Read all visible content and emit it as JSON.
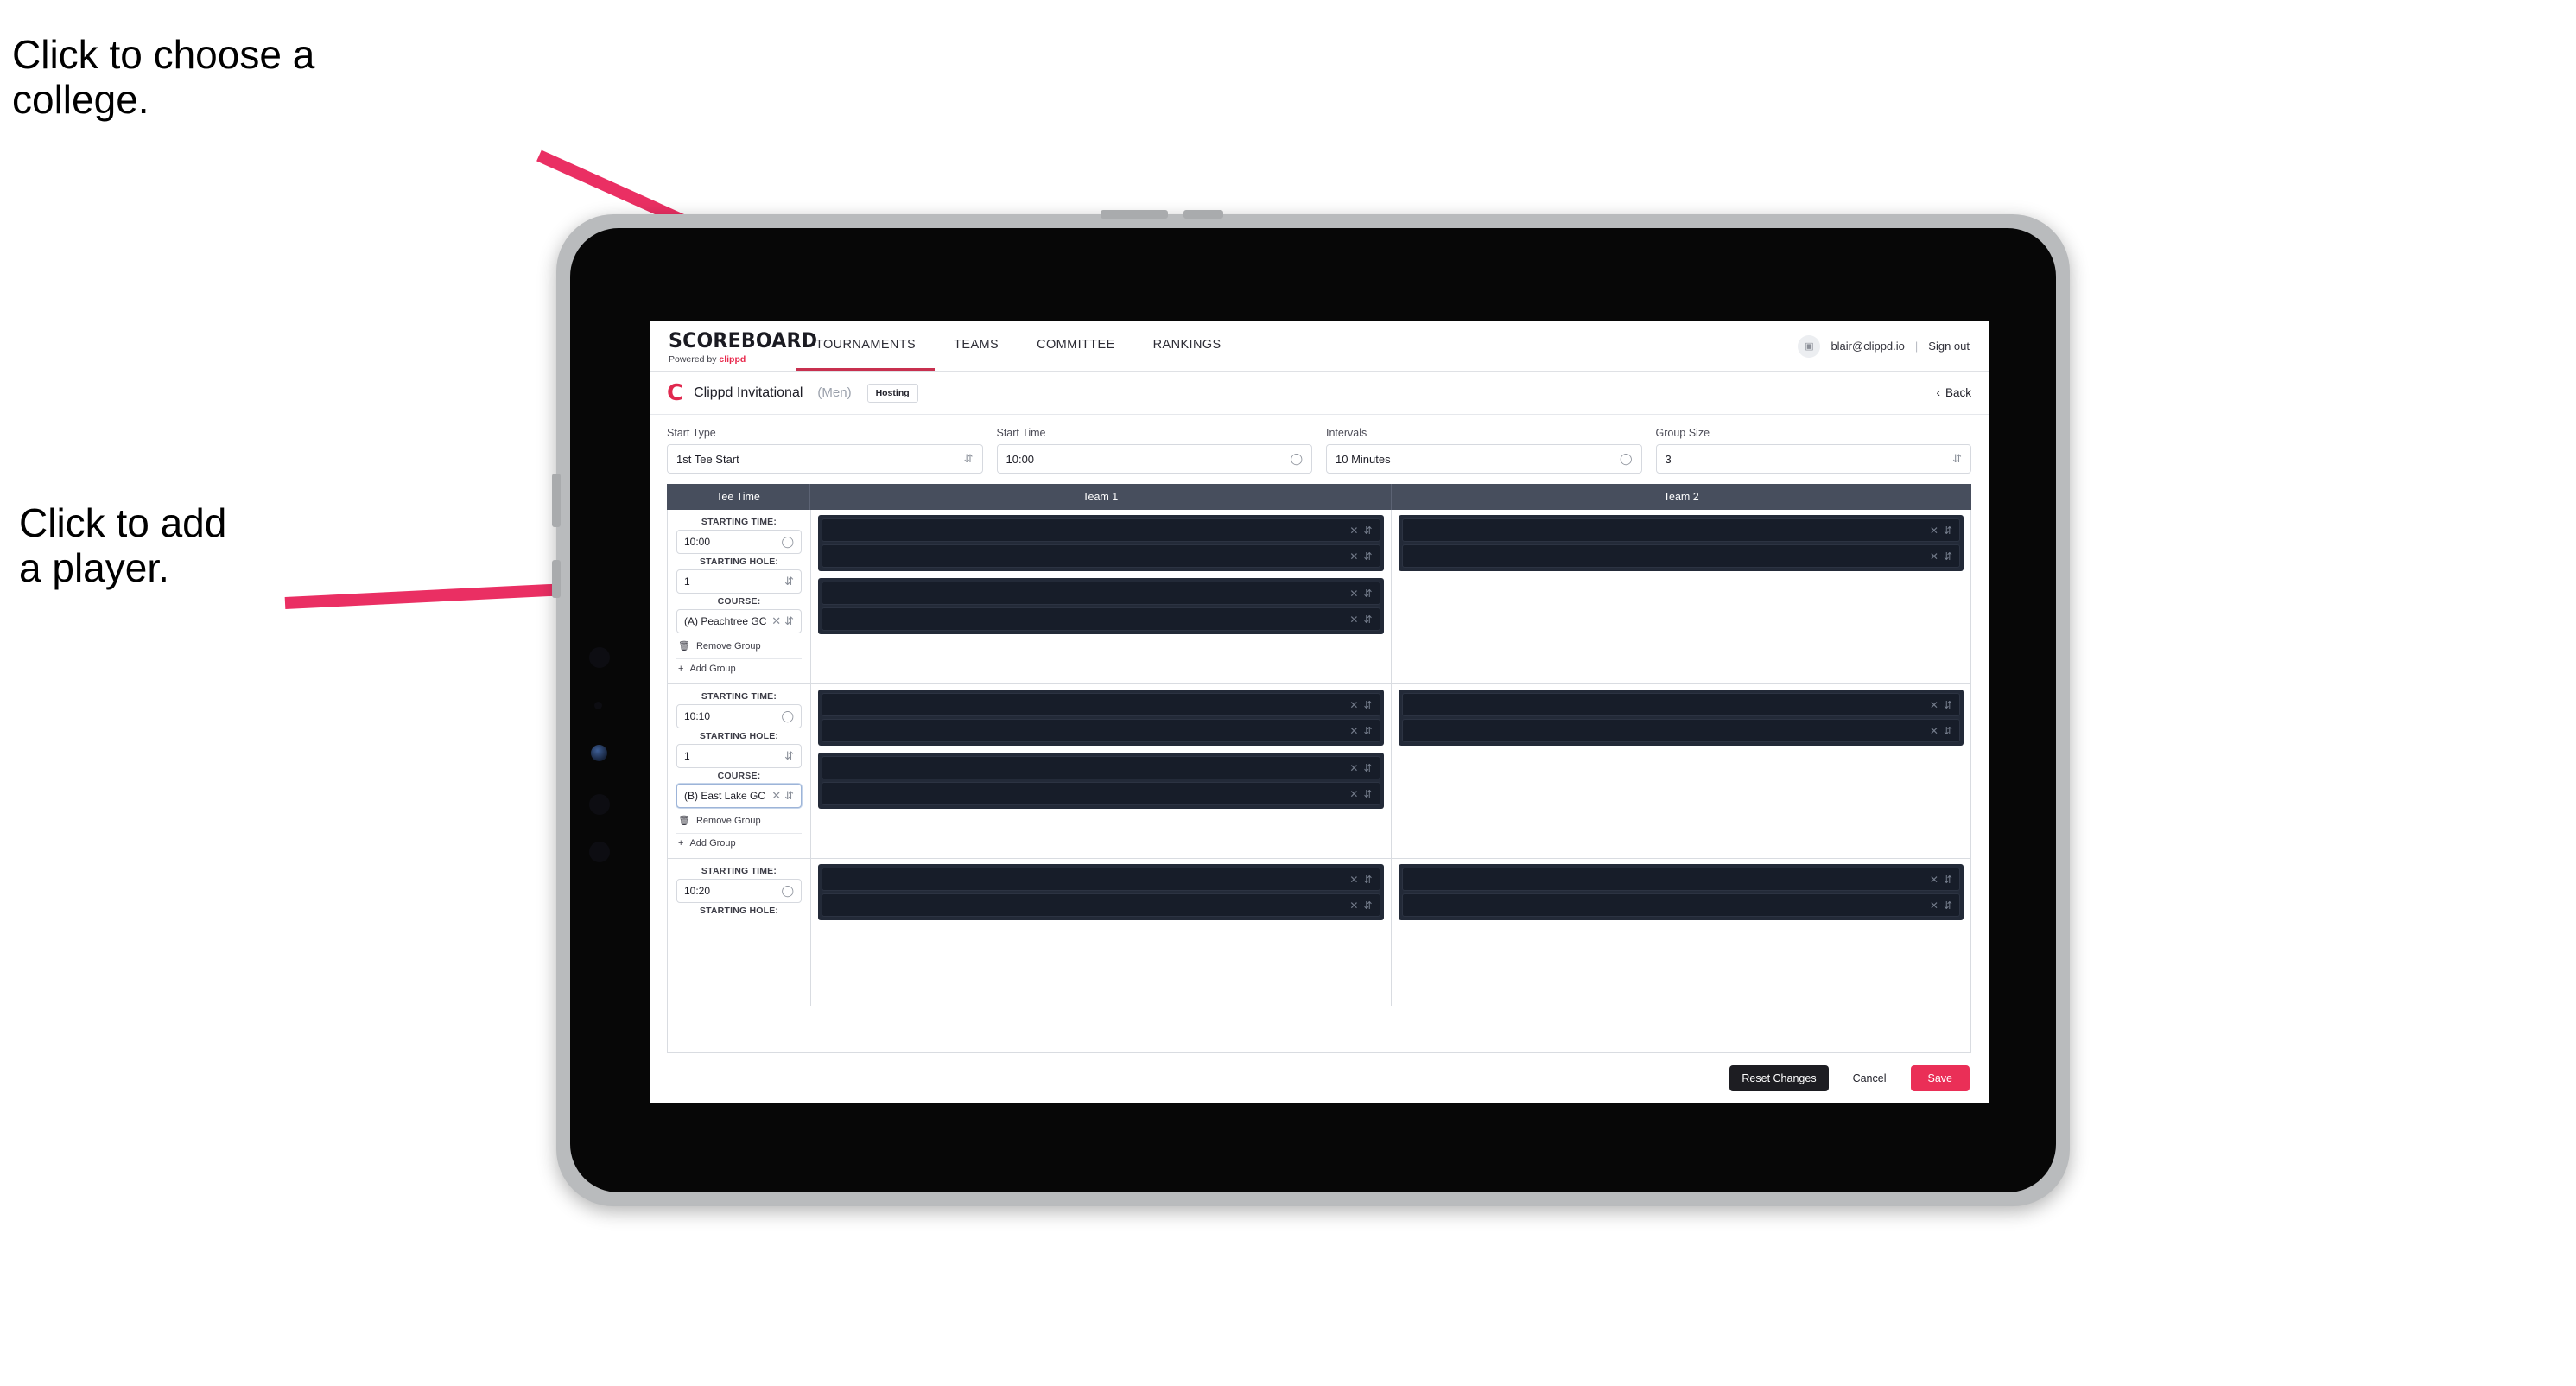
{
  "annotations": [
    {
      "id": "anno-college",
      "text": "Click to choose a\ncollege."
    },
    {
      "id": "anno-player",
      "text": "Click to add\na player."
    }
  ],
  "colors": {
    "accent_pink": "#ea2f57",
    "brand_red": "#e0294f",
    "table_header": "#474e5d",
    "slot_dark": "#171d29",
    "arrow_pink": "#ea2f63"
  },
  "topnav": {
    "brand_title": "SCOREBOARD",
    "brand_sub_prefix": "Powered by ",
    "brand_sub_name": "clippd",
    "tabs": [
      {
        "label": "TOURNAMENTS",
        "active": true
      },
      {
        "label": "TEAMS",
        "active": false
      },
      {
        "label": "COMMITTEE",
        "active": false
      },
      {
        "label": "RANKINGS",
        "active": false
      }
    ],
    "avatar_icon": "user-badge-icon",
    "user_email": "blair@clippd.io",
    "separator": "|",
    "sign_out": "Sign out"
  },
  "tournament_bar": {
    "logo_letter": "C",
    "name": "Clippd Invitational",
    "gender": "(Men)",
    "badge": "Hosting",
    "back_chevron": "‹",
    "back_label": "Back"
  },
  "settings": [
    {
      "label": "Start Type",
      "value": "1st Tee Start",
      "icon": "stepper-icon"
    },
    {
      "label": "Start Time",
      "value": "10:00",
      "icon": "clock-icon"
    },
    {
      "label": "Intervals",
      "value": "10 Minutes",
      "icon": "clock-icon"
    },
    {
      "label": "Group Size",
      "value": "3",
      "icon": "stepper-icon"
    }
  ],
  "table": {
    "columns": [
      "Tee Time",
      "Team 1",
      "Team 2"
    ],
    "labels": {
      "starting_time": "STARTING TIME:",
      "starting_hole": "STARTING HOLE:",
      "course": "COURSE:",
      "remove_group": "Remove Group",
      "add_group": "Add Group",
      "remove_icon": "trash-icon",
      "add_icon": "plus-icon",
      "clear_icon": "close-x-icon",
      "stepper_icon": "stepper-icon",
      "clock_icon": "clock-icon"
    },
    "rows": [
      {
        "starting_time": "10:00",
        "starting_hole": "1",
        "course": "(A) Peachtree GC",
        "course_focused": false,
        "team1_groups": [
          {
            "slots": [
              "",
              ""
            ]
          },
          {
            "slots": [
              "",
              ""
            ]
          }
        ],
        "team2_groups": [
          {
            "slots": [
              "",
              ""
            ]
          }
        ]
      },
      {
        "starting_time": "10:10",
        "starting_hole": "1",
        "course": "(B) East Lake GC",
        "course_focused": true,
        "team1_groups": [
          {
            "slots": [
              "",
              ""
            ]
          },
          {
            "slots": [
              "",
              ""
            ]
          }
        ],
        "team2_groups": [
          {
            "slots": [
              "",
              ""
            ]
          }
        ]
      },
      {
        "starting_time": "10:20",
        "starting_hole": "",
        "course": "",
        "course_focused": false,
        "team1_groups": [
          {
            "slots": [
              "",
              ""
            ]
          }
        ],
        "team2_groups": [
          {
            "slots": [
              "",
              ""
            ]
          }
        ]
      }
    ]
  },
  "footer": {
    "reset": "Reset Changes",
    "cancel": "Cancel",
    "save": "Save"
  }
}
